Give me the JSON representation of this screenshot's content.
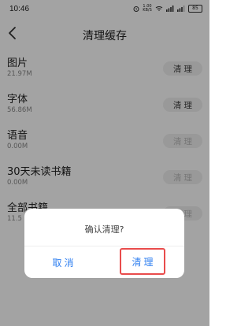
{
  "status_bar": {
    "time": "10:46",
    "speed": "1.00\nKB/S",
    "battery": "85"
  },
  "header": {
    "title": "清理缓存"
  },
  "cache_items": [
    {
      "name": "图片",
      "size": "21.97M",
      "button": "清理",
      "enabled": true
    },
    {
      "name": "字体",
      "size": "56.86M",
      "button": "清理",
      "enabled": true
    },
    {
      "name": "语音",
      "size": "0.00M",
      "button": "清理",
      "enabled": false
    },
    {
      "name": "30天未读书籍",
      "size": "0.00M",
      "button": "清理",
      "enabled": false
    },
    {
      "name": "全部书籍",
      "size": "11.5",
      "button": "清理",
      "enabled": false
    }
  ],
  "dialog": {
    "message": "确认清理?",
    "cancel_label": "取消",
    "confirm_label": "清理"
  },
  "colors": {
    "accent": "#2f7ff0",
    "highlight": "#e94c4c"
  },
  "icons": {
    "back": "chevron-left-icon",
    "alarm": "alarm-icon",
    "wifi": "wifi-icon",
    "signal": "signal-icon"
  }
}
